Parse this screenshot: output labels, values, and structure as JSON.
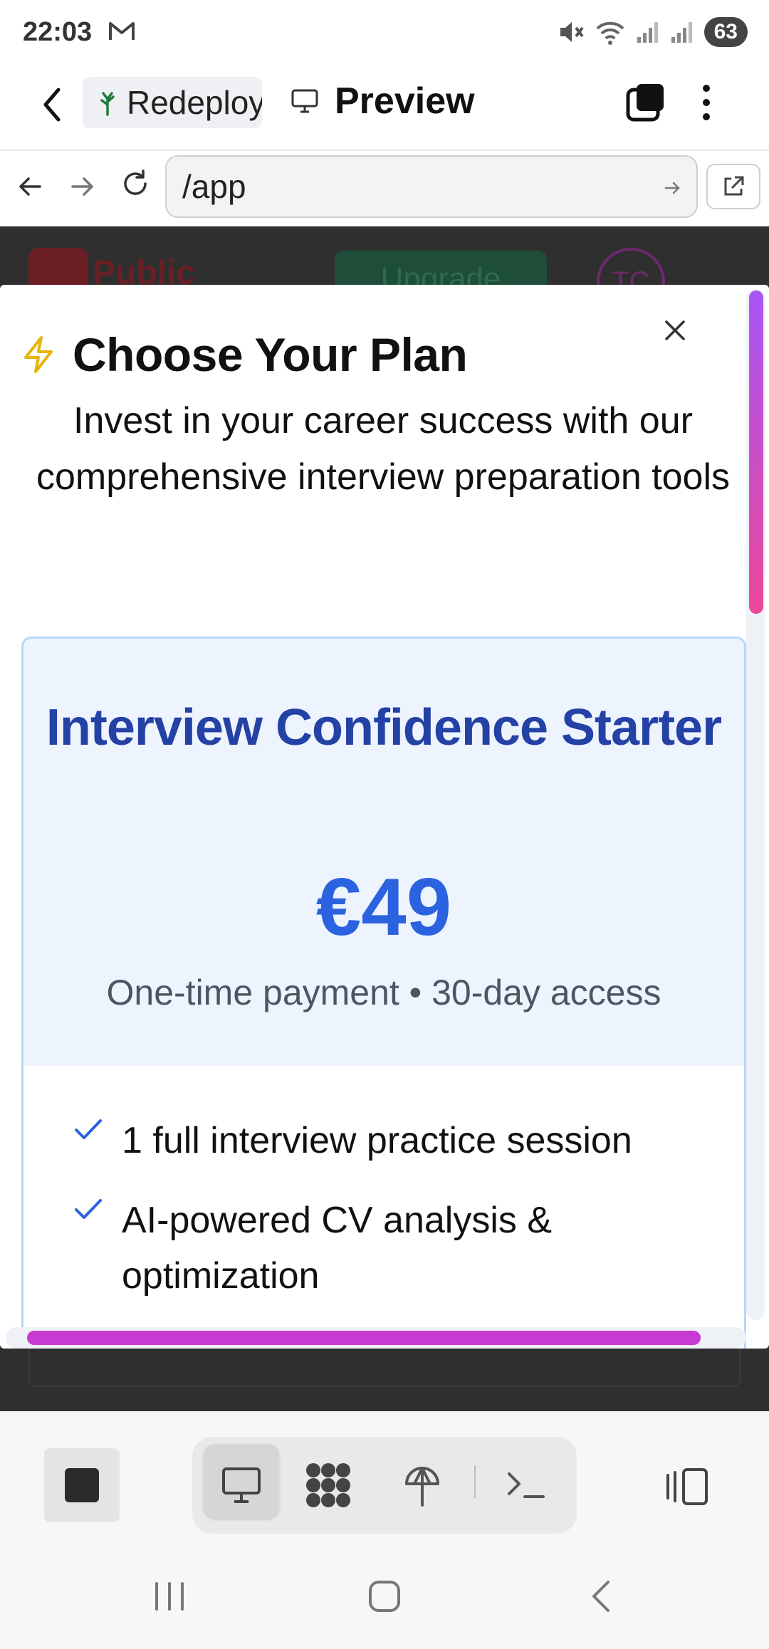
{
  "status_bar": {
    "time": "22:03",
    "battery": "63",
    "icons": [
      "mail-icon",
      "mute-icon",
      "wifi-icon",
      "signal-icon",
      "signal-icon-2"
    ]
  },
  "app_header": {
    "project_label": "Redeploy",
    "view_label": "Preview"
  },
  "browser": {
    "url": "/app"
  },
  "background_app": {
    "badge_text": "Public",
    "upgrade_label": "Upgrade",
    "avatar_initials": "TC"
  },
  "modal": {
    "title": "Choose Your Plan",
    "subtitle": "Invest in your career success with our comprehensive interview preparation tools",
    "plan": {
      "name": "Interview Confidence Starter",
      "price": "€49",
      "note": "One-time payment • 30-day access",
      "features": [
        "1 full interview practice session",
        "AI-powered CV analysis & optimization"
      ]
    }
  },
  "colors": {
    "accent": "#2b62e0",
    "plan_name": "#2441a6",
    "bolt": "#eab308",
    "scroll_gradient": [
      "#a855f7",
      "#ec4899"
    ]
  }
}
